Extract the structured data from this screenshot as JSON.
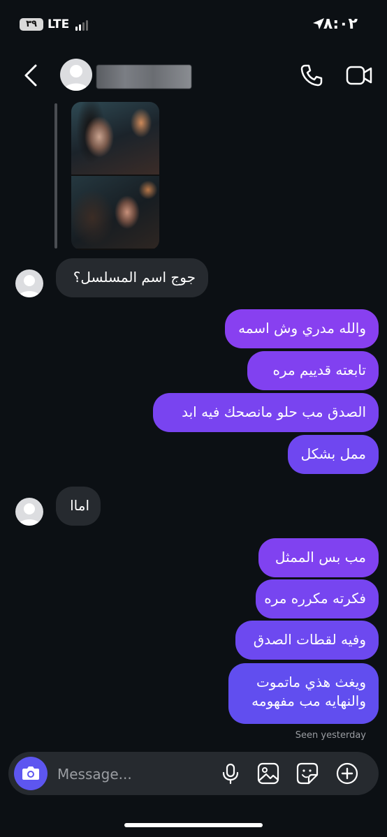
{
  "status_bar": {
    "battery": "٣٩",
    "network": "LTE",
    "time": "٨:٠٢"
  },
  "header": {
    "icons": [
      "back-chevron",
      "profile-avatar",
      "phone",
      "video-camera"
    ]
  },
  "messages": {
    "incoming_1": "جوج اسم المسلسل؟",
    "outgoing_1": "والله مدري وش اسمه",
    "outgoing_2": "تابعته قدييم مره",
    "outgoing_3": "الصدق مب حلو مانصحك فيه ابد",
    "outgoing_4": "ممل بشكل",
    "incoming_2": "اماا",
    "outgoing_5": "مب بس الممثل",
    "outgoing_6": "فكرته مكرره مره",
    "outgoing_7": "وفيه لقطات الصدق",
    "outgoing_8_line1": "ويغث هذي ماتموت",
    "outgoing_8_line2": "والنهايه مب مفهومه"
  },
  "seen_status": "Seen yesterday",
  "composer": {
    "placeholder": "Message...",
    "icons": [
      "camera",
      "microphone",
      "gallery",
      "sticker",
      "add"
    ]
  },
  "colors": {
    "background": "#0c1014",
    "incoming_bubble": "#262a2f",
    "outgoing_top": "#8a3ff0",
    "outgoing_bottom": "#5a52ef",
    "camera_button": "#5d56f0"
  }
}
